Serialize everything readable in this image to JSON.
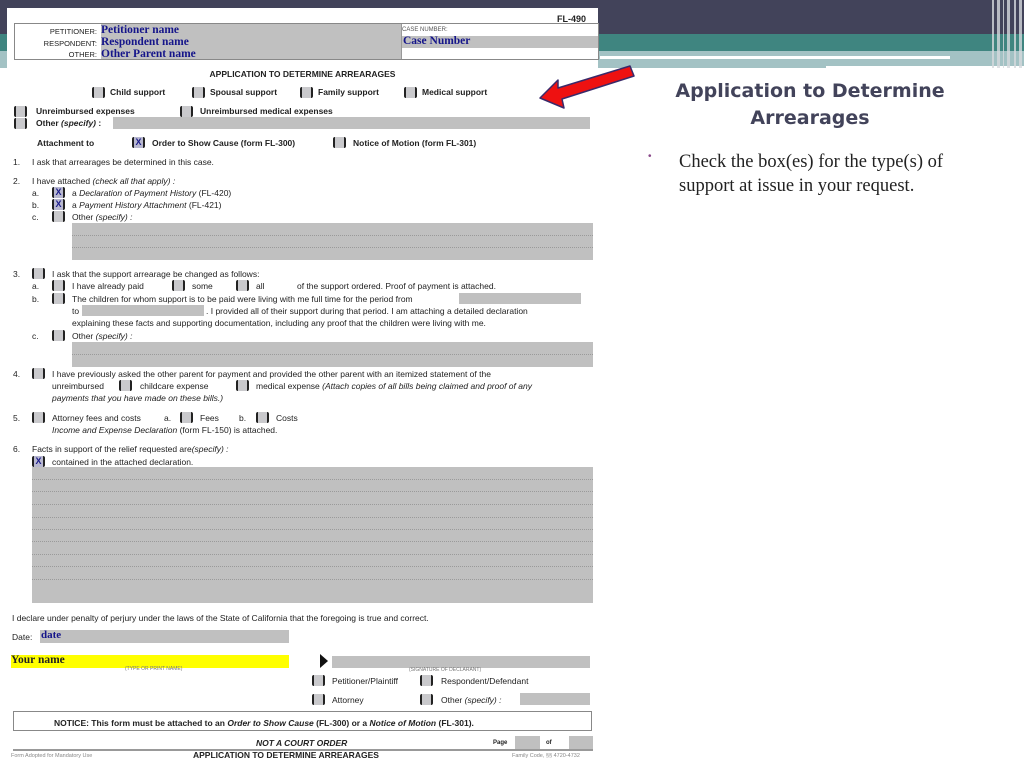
{
  "slide": {
    "title": "Application to Determine Arrearages",
    "bullets": [
      "Check the box(es) for the type(s) of support at issue in your request."
    ],
    "accent_colors": {
      "dark_band": "#42435a",
      "teal_band": "#3f8580",
      "light_band": "#a3c2c4",
      "arrow": "#ee1111",
      "bullet": "#8a4a8a"
    },
    "arrow_icon": "red-arrow-pointing-left"
  },
  "form": {
    "form_number": "FL-490",
    "caption": {
      "petitioner_label": "PETITIONER:",
      "respondent_label": "RESPONDENT:",
      "other_label": "OTHER:",
      "petitioner_value": "Petitioner name",
      "respondent_value": "Respondent name",
      "other_value": "Other Parent name",
      "case_number_label": "CASE NUMBER:",
      "case_number_value": "Case Number"
    },
    "title": "APPLICATION TO DETERMINE ARREARAGES",
    "support_types": [
      {
        "label": "Child support",
        "checked": false
      },
      {
        "label": "Spousal support",
        "checked": false
      },
      {
        "label": "Family support",
        "checked": false
      },
      {
        "label": "Medical support",
        "checked": false
      }
    ],
    "expense_types": [
      {
        "label": "Unreimbursed expenses",
        "checked": false
      },
      {
        "label": "Unreimbursed medical expenses",
        "checked": false
      }
    ],
    "other_specify": {
      "label": "Other",
      "hint": "(specify)",
      "colon": ":",
      "checked": false,
      "value": ""
    },
    "attachment": {
      "label": "Attachment to",
      "options": [
        {
          "label": "Order to Show Cause (form FL-300)",
          "checked": true
        },
        {
          "label": "Notice of Motion (form FL-301)",
          "checked": false
        }
      ]
    },
    "items": {
      "i1": {
        "num": "1.",
        "text": "I ask that arrearages be determined in this case."
      },
      "i2": {
        "num": "2.",
        "text": "I have attached",
        "hint": "(check all that apply) :",
        "a": {
          "letter": "a.",
          "pre": "a",
          "italic": "Declaration of Payment History",
          "post": "(FL-420)",
          "checked": true
        },
        "b": {
          "letter": "b.",
          "pre": "a",
          "italic": "Payment History Attachment",
          "post": "(FL-421)",
          "checked": true
        },
        "c": {
          "letter": "c.",
          "label": "Other",
          "hint": "(specify) :",
          "checked": false
        }
      },
      "i3": {
        "num": "3.",
        "text": "I ask that the support arrearage be changed as follows:",
        "checked": false,
        "a": {
          "letter": "a.",
          "text": "I have already paid",
          "some": "some",
          "all": "all",
          "post": "of the support ordered. Proof of payment is attached."
        },
        "b": {
          "letter": "b.",
          "text": "The children for whom support is to be paid were living with me full time for the period from",
          "to": "to",
          "line2": ". I provided all of their support during that period. I am attaching a detailed declaration",
          "line3": "explaining these facts and supporting documentation, including any proof that the children were living with me."
        },
        "c": {
          "letter": "c.",
          "label": "Other",
          "hint": "(specify) :"
        }
      },
      "i4": {
        "num": "4.",
        "text": "I have previously asked the other parent for payment and provided the other parent with an itemized statement of the",
        "unreimbursed": "unreimbursed",
        "childcare": "childcare expense",
        "medical": "medical expense",
        "note1": "(Attach copies of all bills being claimed and proof of any",
        "note2": "payments that you have made on these bills.)"
      },
      "i5": {
        "num": "5.",
        "text": "Attorney fees and costs",
        "a": "a.",
        "fees": "Fees",
        "b": "b.",
        "costs": "Costs",
        "italic": "Income and Expense Declaration",
        "post": "(form FL-150) is attached."
      },
      "i6": {
        "num": "6.",
        "text": "Facts in support of the relief requested are",
        "hint": "(specify) :",
        "declaration": "contained in the attached declaration.",
        "checked": true
      }
    },
    "declare": "I declare under penalty of perjury under the laws of the State of California that the foregoing is true and correct.",
    "date_label": "Date:",
    "date_value": "date",
    "name_value": "Your name",
    "name_caption": "(TYPE OR PRINT NAME)",
    "signature_caption": "(SIGNATURE OF DECLARANT)",
    "signer_roles": [
      {
        "label": "Petitioner/Plaintiff",
        "checked": false
      },
      {
        "label": "Respondent/Defendant",
        "checked": false
      },
      {
        "label": "Attorney",
        "checked": false
      },
      {
        "label": "Other",
        "hint": "(specify) :",
        "checked": false
      }
    ],
    "notice": {
      "prefix": "NOTICE:  This form must be attached to an",
      "osc": "Order to Show Cause",
      "osc_form": "(FL-300) or a",
      "nom": "Notice of Motion",
      "nom_form": "(FL-301)."
    },
    "footer": {
      "not_order": "NOT A COURT ORDER",
      "page_label": "Page",
      "of_label": "of",
      "adopted": "Form Adopted for Mandatory Use",
      "title": "APPLICATION TO DETERMINE ARREARAGES",
      "code": "Family Code, §§ 4720-4732"
    }
  }
}
